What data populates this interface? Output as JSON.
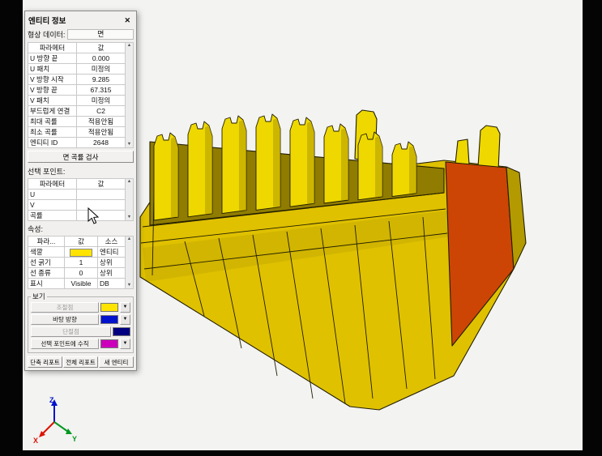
{
  "colors": {
    "canvas_bg": "#f3f3f1",
    "model_yellow": "#dfc100",
    "model_yellow_bright": "#eed800",
    "model_yellow_dark": "#b39a00",
    "model_shadow": "#8f7c00",
    "selected_face_orange": "#cc4505",
    "edge": "#221d00",
    "axis_x": "#dd1100",
    "axis_y": "#009922",
    "axis_z": "#0011cc"
  },
  "dialog": {
    "title": "엔티티 정보",
    "close": "✕",
    "shape": {
      "label": "형상 데이터:",
      "value": "면"
    },
    "param_table": {
      "headers": [
        "파라메터",
        "값"
      ],
      "rows": [
        {
          "name": "U 방향 끝",
          "value": "0.000"
        },
        {
          "name": "U 패치",
          "value": "미정의"
        },
        {
          "name": "V 방향 시작",
          "value": "9.285"
        },
        {
          "name": "V 방향 끝",
          "value": "67.315"
        },
        {
          "name": "V 패치",
          "value": "미정의"
        },
        {
          "name": "부드럽게 연결",
          "value": "C2"
        },
        {
          "name": "최대 곡률",
          "value": "적용안됨"
        },
        {
          "name": "최소 곡률",
          "value": "적용안됨"
        },
        {
          "name": "엔티티 ID",
          "value": "2648"
        }
      ]
    },
    "curvature_button": "면 곡률 검사",
    "selected_point": {
      "label": "선택 포인트:",
      "headers": [
        "파라메터",
        "값"
      ],
      "rows": [
        {
          "name": "U",
          "value": ""
        },
        {
          "name": "V",
          "value": ""
        },
        {
          "name": "곡률",
          "value": ""
        }
      ]
    },
    "properties": {
      "label": "속성:",
      "headers": [
        "파라...",
        "값",
        "소스"
      ],
      "rows": [
        {
          "name": "색깔",
          "value": "",
          "swatch": "#ffe400",
          "source": "엔티티"
        },
        {
          "name": "선 굵기",
          "value": "1",
          "source": "상위"
        },
        {
          "name": "선 종류",
          "value": "0",
          "source": "상위"
        },
        {
          "name": "표시",
          "value": "Visible",
          "source": "DB"
        }
      ]
    },
    "view": {
      "label": "보기",
      "rows": [
        {
          "label": "조절점",
          "swatch": "#ffe400",
          "dropdown": true,
          "enabled": false
        },
        {
          "label": "바탕 방향",
          "swatch": "#0012cc",
          "dropdown": true,
          "enabled": true
        },
        {
          "label": "단절점",
          "swatch": "#000080",
          "dropdown": false,
          "enabled": false
        },
        {
          "label": "선택 포인트에 수직",
          "swatch": "#cc00bb",
          "dropdown": true,
          "enabled": true
        }
      ]
    },
    "footer_buttons": [
      "단축 리포트",
      "전체 리포트",
      "새 엔티티"
    ]
  },
  "axis_triad": {
    "x": "X",
    "y": "Y",
    "z": "Z"
  }
}
